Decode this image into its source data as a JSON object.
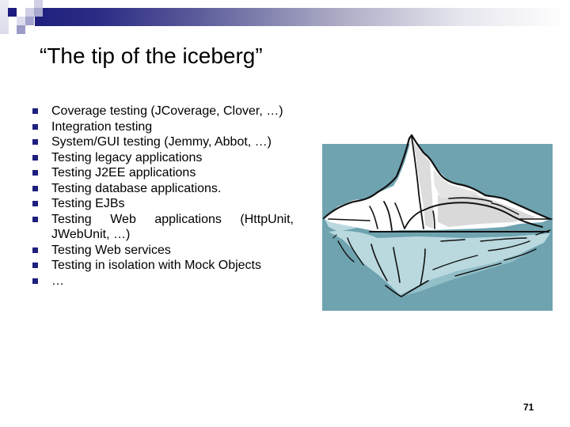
{
  "slide": {
    "title": "“The tip of the iceberg”",
    "page_number": "71",
    "accent_color": "#1f1f7e",
    "bullets": [
      {
        "text": "Coverage testing (JCoverage, Clover, …)"
      },
      {
        "text": "Integration testing"
      },
      {
        "text": "System/GUI testing (Jemmy, Abbot, …)"
      },
      {
        "text": "Testing legacy applications"
      },
      {
        "text": "Testing J2EE applications"
      },
      {
        "text": "Testing database applications."
      },
      {
        "text": "Testing EJBs"
      },
      {
        "text": "Testing Web applications (HttpUnit, JWebUnit, …)"
      },
      {
        "text": "Testing Web services"
      },
      {
        "text": "Testing in isolation with Mock Objects"
      },
      {
        "text": "…"
      }
    ],
    "picture": {
      "subject": "iceberg clip-art",
      "colors": {
        "water": "#6fa3b0",
        "ice": "#ffffff",
        "ice_shadow": "#d9d9d9",
        "underwater_ice": "#b9d9df",
        "underwater_shadow": "#93bfc9",
        "outline": "#111111"
      }
    }
  }
}
